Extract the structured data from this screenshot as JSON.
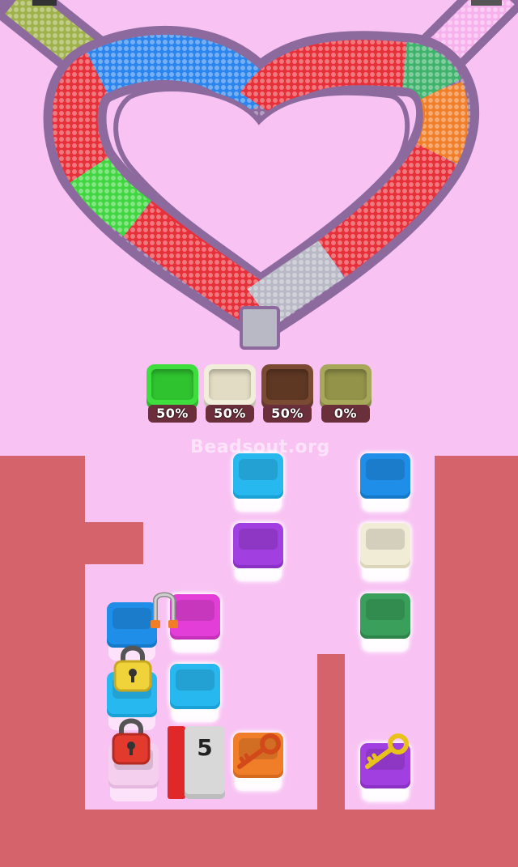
{
  "watermark": "Beadsout.org",
  "collection_cups": [
    {
      "color": "#3fde3f",
      "percent": "50%"
    },
    {
      "color": "#f2eedc",
      "percent": "50%"
    },
    {
      "color": "#7a4a32",
      "percent": "50%"
    },
    {
      "color": "#a8a85a",
      "percent": "0%"
    }
  ],
  "queue_counter": "5",
  "tray_blocks": [
    {
      "color": "#27b8f0",
      "state": "open"
    },
    {
      "color": "#1f8ee8",
      "state": "open"
    },
    {
      "color": "#a23fe0",
      "state": "open"
    },
    {
      "color": "#f1ecd6",
      "state": "open"
    },
    {
      "color": "#1f8ee8",
      "state": "open"
    },
    {
      "color": "#e33fd8",
      "state": "hooked"
    },
    {
      "color": "#3a9f5a",
      "state": "open"
    },
    {
      "color": "#27b8f0",
      "state": "locked"
    },
    {
      "color": "#27b8f0",
      "state": "open"
    },
    {
      "color": "#f4d0ee",
      "state": "locked"
    },
    {
      "color": "#f07e28",
      "state": "key"
    },
    {
      "color": "#a23fe0",
      "state": "key"
    }
  ],
  "icons": [
    "padlock-icon",
    "key-icon",
    "hook-icon"
  ],
  "colors": {
    "background": "#f8c2f3",
    "wall": "#d5636b",
    "track": "#8d6a9e"
  }
}
